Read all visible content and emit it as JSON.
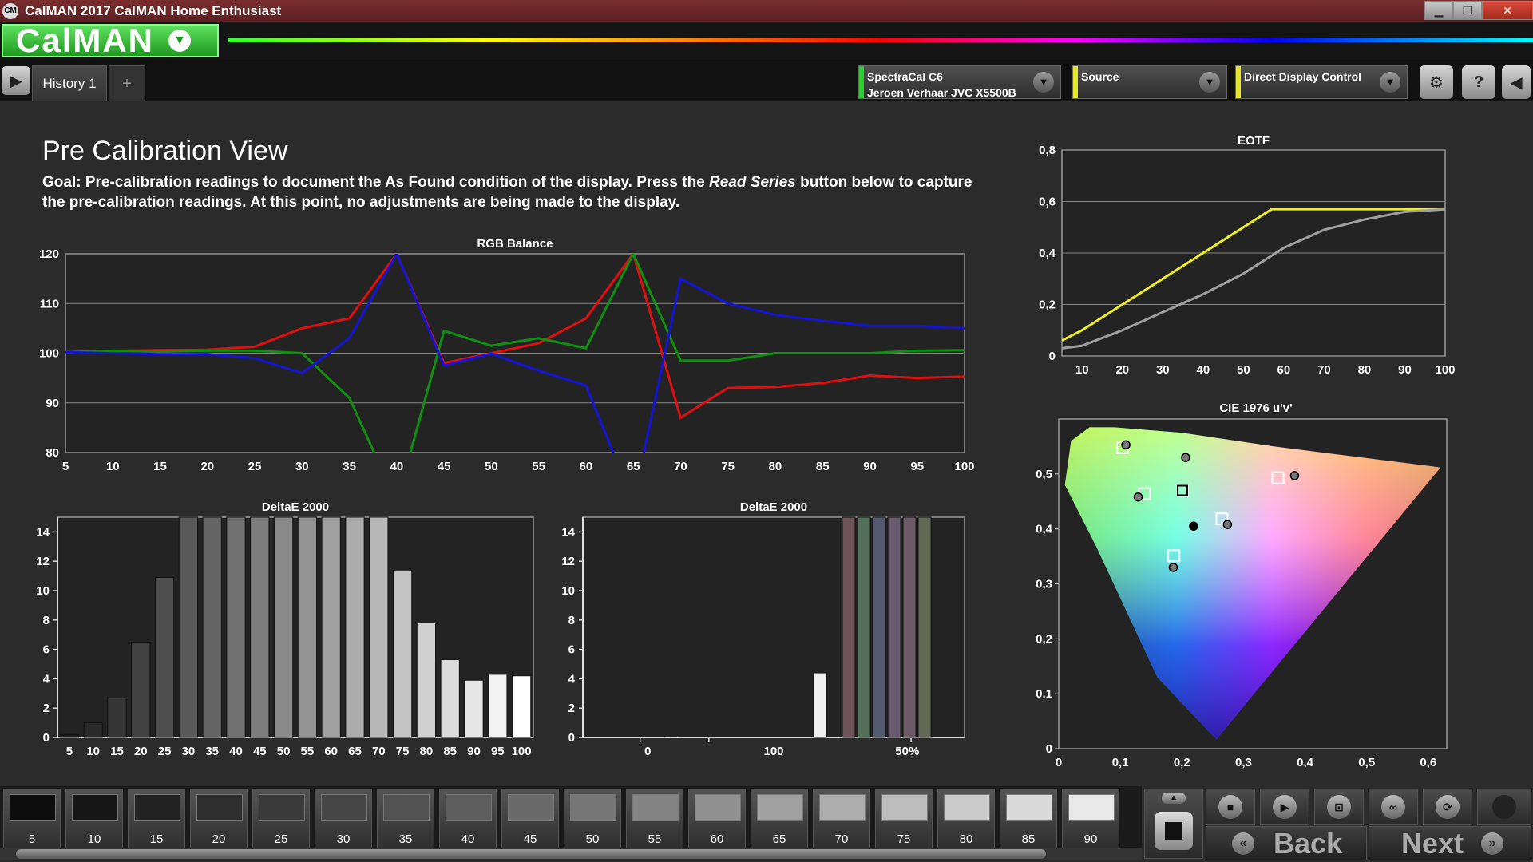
{
  "window": {
    "title": "CalMAN 2017 CalMAN Home Enthusiast",
    "app_icon": "CM"
  },
  "logo": {
    "text": "CalMAN"
  },
  "tabs": [
    {
      "label": "History 1"
    }
  ],
  "tab_add_label": "+",
  "devices": {
    "meter": {
      "line1": "SpectraCal C6",
      "line2": "Jeroen Verhaar JVC X5500B",
      "color": "#2ecc2e"
    },
    "source": {
      "line1": "Source",
      "color": "#e6e62e"
    },
    "display": {
      "line1": "Direct Display Control",
      "color": "#e6e62e"
    }
  },
  "toolbar_icons": {
    "settings": "gear-icon",
    "help": "?",
    "collapse": "chevron-left-icon"
  },
  "page": {
    "title": "Pre Calibration View",
    "goal_prefix": "Goal: Pre-calibration readings to document the As Found condition of the display. Press the ",
    "goal_em": "Read Series",
    "goal_suffix": " button below to capture the pre-calibration readings. At this point, no adjustments are being made to the display."
  },
  "chart_data": [
    {
      "id": "rgb_balance",
      "type": "line",
      "title": "RGB Balance",
      "x": [
        5,
        10,
        15,
        20,
        25,
        30,
        35,
        40,
        45,
        50,
        55,
        60,
        65,
        70,
        75,
        80,
        85,
        90,
        95,
        100
      ],
      "xlim": [
        5,
        100
      ],
      "ylim": [
        80,
        120
      ],
      "yticks": [
        80,
        90,
        100,
        110,
        120
      ],
      "grid": true,
      "series": [
        {
          "color": "#e01010",
          "values": [
            100.2,
            100.5,
            100.6,
            100.7,
            101.3,
            105,
            107,
            120,
            98,
            100,
            102,
            107,
            120,
            87,
            93,
            93.2,
            94,
            95.5,
            95,
            95.3
          ]
        },
        {
          "color": "#109010",
          "values": [
            100.2,
            100.5,
            100.3,
            100.5,
            100.5,
            100,
            91,
            70,
            104.5,
            101.5,
            103,
            101,
            120,
            98.5,
            98.5,
            100,
            100,
            100,
            100.5,
            100.6
          ]
        },
        {
          "color": "#1414d8",
          "values": [
            100.2,
            100,
            99.8,
            99.8,
            99,
            96,
            103,
            120,
            97.5,
            99.9,
            96.5,
            93.5,
            70,
            115,
            110,
            107.7,
            106.5,
            105.5,
            105.5,
            105
          ]
        }
      ]
    },
    {
      "id": "eotf",
      "type": "line",
      "title": "EOTF",
      "x": [
        5,
        10,
        20,
        30,
        40,
        50,
        55,
        57,
        60,
        70,
        80,
        90,
        100
      ],
      "xlim": [
        5,
        100
      ],
      "ylim": [
        0,
        0.8
      ],
      "yticks": [
        "0",
        "0,2",
        "0,4",
        "0,6",
        "0,8"
      ],
      "xticks": [
        10,
        20,
        30,
        40,
        50,
        60,
        70,
        80,
        90,
        100
      ],
      "grid": true,
      "series": [
        {
          "color": "#f0f020",
          "values": [
            0.06,
            0.1,
            0.2,
            0.3,
            0.4,
            0.5,
            0.55,
            0.57,
            0.57,
            0.57,
            0.57,
            0.57,
            0.57
          ]
        },
        {
          "color": "#a0a0a0",
          "values": [
            0.03,
            0.04,
            0.1,
            0.17,
            0.24,
            0.32,
            0.37,
            0.39,
            0.42,
            0.49,
            0.53,
            0.56,
            0.57
          ]
        }
      ]
    },
    {
      "id": "deltae_grayscale",
      "type": "bar",
      "title": "DeltaE 2000",
      "categories": [
        "5",
        "10",
        "15",
        "20",
        "25",
        "30",
        "35",
        "40",
        "45",
        "50",
        "55",
        "60",
        "65",
        "70",
        "75",
        "80",
        "85",
        "90",
        "95",
        "100"
      ],
      "values": [
        0.2,
        1,
        2.7,
        6.5,
        10.9,
        15,
        15,
        15,
        15,
        15,
        15,
        15,
        15,
        15,
        11.4,
        7.8,
        5.3,
        3.9,
        4.3,
        4.2
      ],
      "ylim": [
        0,
        15
      ],
      "yticks": [
        0,
        2,
        4,
        6,
        8,
        10,
        12,
        14
      ]
    },
    {
      "id": "deltae_saturation",
      "type": "bar",
      "title": "DeltaE 2000",
      "categories": [
        "0",
        "100",
        "50%"
      ],
      "values": [
        0,
        4.4,
        15,
        15,
        15,
        15,
        15,
        15
      ],
      "ylim": [
        0,
        15
      ],
      "yticks": [
        0,
        2,
        4,
        6,
        8,
        10,
        12,
        14
      ]
    },
    {
      "id": "cie1976",
      "type": "scatter",
      "title": "CIE 1976 u'v'",
      "xlim": [
        0,
        0.63
      ],
      "ylim": [
        0,
        0.6
      ],
      "xticks": [
        "0",
        "0,1",
        "0,2",
        "0,3",
        "0,4",
        "0,5",
        "0,6"
      ],
      "yticks": [
        "0",
        "0,1",
        "0,2",
        "0,3",
        "0,4",
        "0,5"
      ],
      "targets": [
        {
          "u": 0.104,
          "v": 0.548
        },
        {
          "u": 0.139,
          "v": 0.464
        },
        {
          "u": 0.201,
          "v": 0.47
        },
        {
          "u": 0.356,
          "v": 0.493
        },
        {
          "u": 0.265,
          "v": 0.418
        },
        {
          "u": 0.187,
          "v": 0.351
        }
      ],
      "measured": [
        {
          "u": 0.109,
          "v": 0.553
        },
        {
          "u": 0.129,
          "v": 0.458
        },
        {
          "u": 0.206,
          "v": 0.53
        },
        {
          "u": 0.383,
          "v": 0.497
        },
        {
          "u": 0.274,
          "v": 0.408
        },
        {
          "u": 0.186,
          "v": 0.33
        },
        {
          "u": 0.219,
          "v": 0.405
        }
      ]
    }
  ],
  "patches": [
    {
      "label": "5",
      "color": "#0d0d0d"
    },
    {
      "label": "10",
      "color": "#161616"
    },
    {
      "label": "15",
      "color": "#222222"
    },
    {
      "label": "20",
      "color": "#2e2e2e"
    },
    {
      "label": "25",
      "color": "#3a3a3a"
    },
    {
      "label": "30",
      "color": "#464646"
    },
    {
      "label": "35",
      "color": "#525252"
    },
    {
      "label": "40",
      "color": "#5e5e5e"
    },
    {
      "label": "45",
      "color": "#6a6a6a"
    },
    {
      "label": "50",
      "color": "#777777"
    },
    {
      "label": "55",
      "color": "#848484"
    },
    {
      "label": "60",
      "color": "#919191"
    },
    {
      "label": "65",
      "color": "#a0a0a0"
    },
    {
      "label": "70",
      "color": "#aeaeae"
    },
    {
      "label": "75",
      "color": "#bdbdbd"
    },
    {
      "label": "80",
      "color": "#cbcbcb"
    },
    {
      "label": "85",
      "color": "#dadada"
    },
    {
      "label": "90",
      "color": "#e9e9e9"
    }
  ],
  "nav": {
    "back": "Back",
    "next": "Next"
  }
}
